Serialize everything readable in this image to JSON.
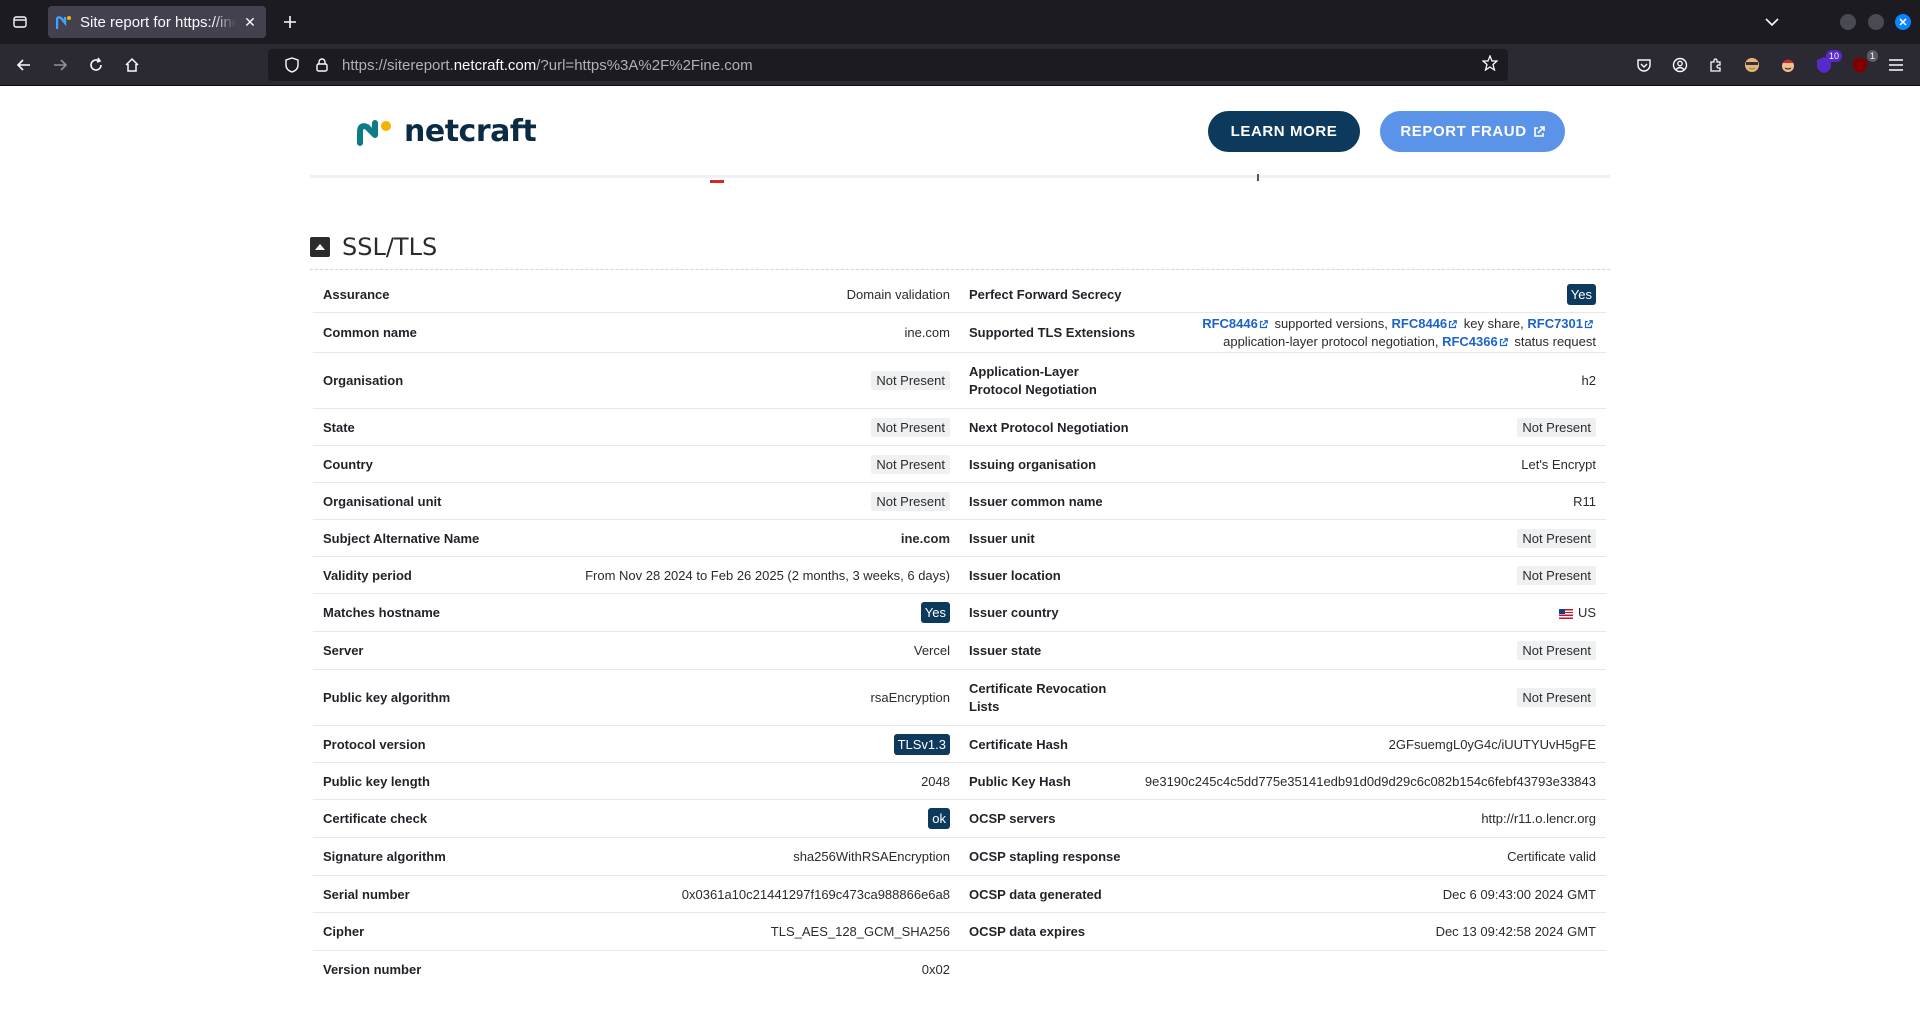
{
  "browser": {
    "tab_title": "Site report for https://ine.com",
    "url_prefix": "https://sitereport.",
    "url_host": "netcraft.com",
    "url_suffix": "/?url=https%3A%2F%2Fine.com",
    "ext_badge_1": "10",
    "ext_badge_2": "1"
  },
  "header": {
    "logo_text": "netcraft",
    "learn_more": "LEARN MORE",
    "report_fraud": "REPORT FRAUD"
  },
  "section": {
    "title": "SSL/TLS"
  },
  "left_rows": [
    {
      "label": "Assurance",
      "value": "Domain validation"
    },
    {
      "label": "Common name",
      "value": "ine.com"
    },
    {
      "label": "Organisation",
      "value": "Not Present"
    },
    {
      "label": "State",
      "value": "Not Present"
    },
    {
      "label": "Country",
      "value": "Not Present"
    },
    {
      "label": "Organisational unit",
      "value": "Not Present"
    },
    {
      "label": "Subject Alternative Name",
      "value": "ine.com"
    },
    {
      "label": "Validity period",
      "value": "From Nov 28 2024 to Feb 26 2025 (2 months, 3 weeks, 6 days)"
    },
    {
      "label": "Matches hostname",
      "value": "Yes"
    },
    {
      "label": "Server",
      "value": "Vercel"
    },
    {
      "label": "Public key algorithm",
      "value": "rsaEncryption"
    },
    {
      "label": "Protocol version",
      "value": "TLSv1.3"
    },
    {
      "label": "Public key length",
      "value": "2048"
    },
    {
      "label": "Certificate check",
      "value": "ok"
    },
    {
      "label": "Signature algorithm",
      "value": "sha256WithRSAEncryption"
    },
    {
      "label": "Serial number",
      "value": "0x0361a10c21441297f169c473ca988866e6a8"
    },
    {
      "label": "Cipher",
      "value": "TLS_AES_128_GCM_SHA256"
    },
    {
      "label": "Version number",
      "value": "0x02"
    }
  ],
  "right_rows": [
    {
      "label": "Perfect Forward Secrecy",
      "value": "Yes"
    },
    {
      "label": "Supported TLS Extensions",
      "ext": {
        "rfc1": "RFC8446",
        "t1": " supported versions, ",
        "rfc2": "RFC8446",
        "t2": " key share, ",
        "rfc3": "RFC7301",
        "t3": " application-layer protocol negotiation, ",
        "rfc4": "RFC4366",
        "t4": " status request"
      }
    },
    {
      "label": "Application-Layer Protocol Negotiation",
      "value": "h2"
    },
    {
      "label": "Next Protocol Negotiation",
      "value": "Not Present"
    },
    {
      "label": "Issuing organisation",
      "value": "Let's Encrypt"
    },
    {
      "label": "Issuer common name",
      "value": "R11"
    },
    {
      "label": "Issuer unit",
      "value": "Not Present"
    },
    {
      "label": "Issuer location",
      "value": "Not Present"
    },
    {
      "label": "Issuer country",
      "value": "US"
    },
    {
      "label": "Issuer state",
      "value": "Not Present"
    },
    {
      "label": "Certificate Revocation Lists",
      "value": "Not Present"
    },
    {
      "label": "Certificate Hash",
      "value": "2GFsuemgL0yG4c/iUUTYUvH5gFE"
    },
    {
      "label": "Public Key Hash",
      "value": "9e3190c245c4c5dd775e35141edb91d0d9d29c6c082b154c6febf43793e33843"
    },
    {
      "label": "OCSP servers",
      "value": "http://r11.o.lencr.org"
    },
    {
      "label": "OCSP stapling response",
      "value": "Certificate valid"
    },
    {
      "label": "OCSP data generated",
      "value": "Dec 6 09:43:00 2024 GMT"
    },
    {
      "label": "OCSP data expires",
      "value": "Dec 13 09:42:58 2024 GMT"
    }
  ]
}
